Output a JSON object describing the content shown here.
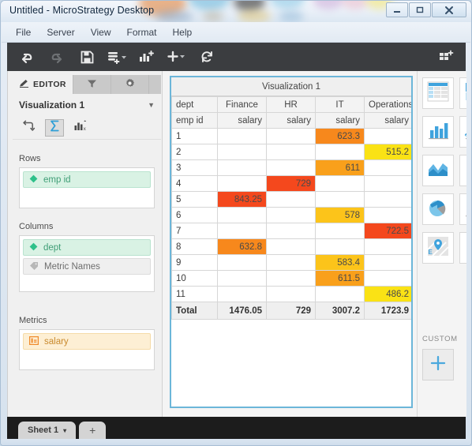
{
  "window": {
    "title": "Untitled - MicroStrategy Desktop",
    "controls": {
      "minimize": "–",
      "restore": "❐",
      "close": "✕"
    }
  },
  "menu": {
    "items": [
      {
        "label": "File"
      },
      {
        "label": "Server"
      },
      {
        "label": "View"
      },
      {
        "label": "Format"
      },
      {
        "label": "Help"
      }
    ]
  },
  "toolbar": {
    "buttons": [
      {
        "name": "undo-icon",
        "title": "Undo"
      },
      {
        "name": "redo-icon",
        "title": "Redo"
      },
      {
        "name": "save-icon",
        "title": "Save"
      },
      {
        "name": "add-data-icon",
        "title": "Add Data"
      },
      {
        "name": "add-visualization-icon",
        "title": "Add Visualization"
      },
      {
        "name": "insert-icon",
        "title": "Insert"
      },
      {
        "name": "refresh-icon",
        "title": "Refresh"
      }
    ],
    "right_button": {
      "name": "add-panel-icon",
      "title": "Add Panel"
    }
  },
  "editor": {
    "tabs": [
      {
        "label": "EDITOR",
        "icon": "pencil-icon",
        "active": true
      },
      {
        "label": "",
        "icon": "filter-icon",
        "active": false
      },
      {
        "label": "",
        "icon": "gear-icon",
        "active": false
      }
    ],
    "visualization_name": "Visualization 1",
    "icon_row": [
      {
        "name": "swap-axes-icon",
        "active": false
      },
      {
        "name": "totals-sigma-icon",
        "active": true
      },
      {
        "name": "sort-chart-icon",
        "active": false
      }
    ],
    "sections": [
      {
        "label": "Rows",
        "chips": [
          {
            "label": "emp id",
            "type": "attribute",
            "icon": "attribute-diamond-icon"
          }
        ]
      },
      {
        "label": "Columns",
        "chips": [
          {
            "label": "dept",
            "type": "attribute",
            "icon": "attribute-diamond-icon"
          },
          {
            "label": "Metric Names",
            "type": "neutral",
            "icon": "metric-names-tag-icon"
          }
        ]
      },
      {
        "label": "Metrics",
        "chips": [
          {
            "label": "salary",
            "type": "metric",
            "icon": "metric-bars-icon"
          }
        ]
      }
    ]
  },
  "visualization": {
    "title": "Visualization 1",
    "chart_data": {
      "type": "table",
      "title": "Visualization 1",
      "row_header_labels": [
        "dept",
        "emp id"
      ],
      "categories": [
        "Finance",
        "HR",
        "IT",
        "Operations"
      ],
      "metric_label": "salary",
      "rows": [
        {
          "emp_id": "1",
          "cells": [
            {
              "v": "",
              "c": ""
            },
            {
              "v": "",
              "c": ""
            },
            {
              "v": "623.3",
              "c": "#f7881c"
            },
            {
              "v": "",
              "c": ""
            }
          ]
        },
        {
          "emp_id": "2",
          "cells": [
            {
              "v": "",
              "c": ""
            },
            {
              "v": "",
              "c": ""
            },
            {
              "v": "",
              "c": ""
            },
            {
              "v": "515.2",
              "c": "#fae215"
            }
          ]
        },
        {
          "emp_id": "3",
          "cells": [
            {
              "v": "",
              "c": ""
            },
            {
              "v": "",
              "c": ""
            },
            {
              "v": "611",
              "c": "#f9a01b"
            },
            {
              "v": "",
              "c": ""
            }
          ]
        },
        {
          "emp_id": "4",
          "cells": [
            {
              "v": "",
              "c": ""
            },
            {
              "v": "729",
              "c": "#f4481d"
            },
            {
              "v": "",
              "c": ""
            },
            {
              "v": "",
              "c": ""
            }
          ]
        },
        {
          "emp_id": "5",
          "cells": [
            {
              "v": "843.25",
              "c": "#f4481d"
            },
            {
              "v": "",
              "c": ""
            },
            {
              "v": "",
              "c": ""
            },
            {
              "v": "",
              "c": ""
            }
          ]
        },
        {
          "emp_id": "6",
          "cells": [
            {
              "v": "",
              "c": ""
            },
            {
              "v": "",
              "c": ""
            },
            {
              "v": "578",
              "c": "#fcc41a"
            },
            {
              "v": "",
              "c": ""
            }
          ]
        },
        {
          "emp_id": "7",
          "cells": [
            {
              "v": "",
              "c": ""
            },
            {
              "v": "",
              "c": ""
            },
            {
              "v": "",
              "c": ""
            },
            {
              "v": "722.5",
              "c": "#f4481d"
            }
          ]
        },
        {
          "emp_id": "8",
          "cells": [
            {
              "v": "632.8",
              "c": "#f7881c"
            },
            {
              "v": "",
              "c": ""
            },
            {
              "v": "",
              "c": ""
            },
            {
              "v": "",
              "c": ""
            }
          ]
        },
        {
          "emp_id": "9",
          "cells": [
            {
              "v": "",
              "c": ""
            },
            {
              "v": "",
              "c": ""
            },
            {
              "v": "583.4",
              "c": "#fcc41a"
            },
            {
              "v": "",
              "c": ""
            }
          ]
        },
        {
          "emp_id": "10",
          "cells": [
            {
              "v": "",
              "c": ""
            },
            {
              "v": "",
              "c": ""
            },
            {
              "v": "611.5",
              "c": "#f9a01b"
            },
            {
              "v": "",
              "c": ""
            }
          ]
        },
        {
          "emp_id": "11",
          "cells": [
            {
              "v": "",
              "c": ""
            },
            {
              "v": "",
              "c": ""
            },
            {
              "v": "",
              "c": ""
            },
            {
              "v": "486.2",
              "c": "#fae215"
            }
          ]
        }
      ],
      "total_label": "Total",
      "totals": [
        "1476.05",
        "729",
        "3007.2",
        "1723.9"
      ]
    }
  },
  "gallery": {
    "items": [
      {
        "name": "grid-table-icon"
      },
      {
        "name": "heat-map-icon"
      },
      {
        "name": "bar-chart-icon"
      },
      {
        "name": "line-chart-icon"
      },
      {
        "name": "area-chart-icon"
      },
      {
        "name": "bubble-chart-icon"
      },
      {
        "name": "pie-chart-icon"
      },
      {
        "name": "combo-chart-icon"
      },
      {
        "name": "map-icon"
      },
      {
        "name": "network-icon"
      }
    ],
    "custom_label": "CUSTOM",
    "custom_add": "+"
  },
  "sheets": {
    "tabs": [
      {
        "label": "Sheet 1",
        "caret": "▾"
      }
    ],
    "add_label": "+"
  }
}
